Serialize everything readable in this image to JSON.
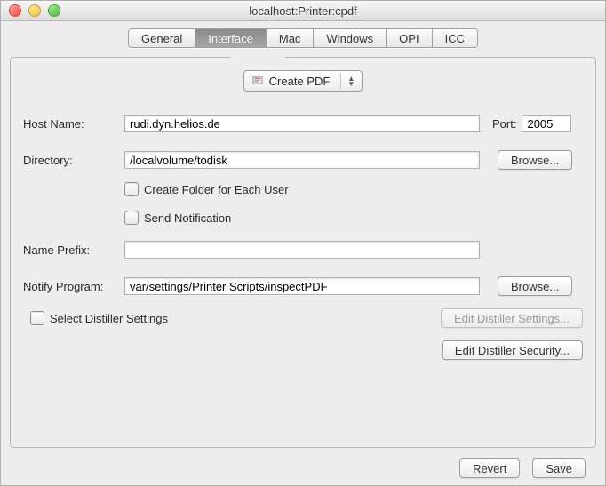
{
  "window_title": "localhost:Printer:cpdf",
  "tabs": {
    "general": "General",
    "interface": "Interface",
    "mac": "Mac",
    "windows": "Windows",
    "opi": "OPI",
    "icc": "ICC"
  },
  "mode_popup": "Create PDF",
  "labels": {
    "host_name": "Host Name:",
    "port": "Port:",
    "directory": "Directory:",
    "name_prefix": "Name Prefix:",
    "notify_program": "Notify Program:"
  },
  "values": {
    "host_name": "rudi.dyn.helios.de",
    "port": "2005",
    "directory": "/localvolume/todisk",
    "name_prefix": "",
    "notify_program": "var/settings/Printer Scripts/inspectPDF"
  },
  "checkboxes": {
    "create_folder": "Create Folder for Each User",
    "send_notification": "Send Notification",
    "select_distiller": "Select Distiller Settings"
  },
  "buttons": {
    "browse": "Browse...",
    "edit_distiller_settings": "Edit Distiller Settings...",
    "edit_distiller_security": "Edit Distiller Security...",
    "revert": "Revert",
    "save": "Save"
  }
}
